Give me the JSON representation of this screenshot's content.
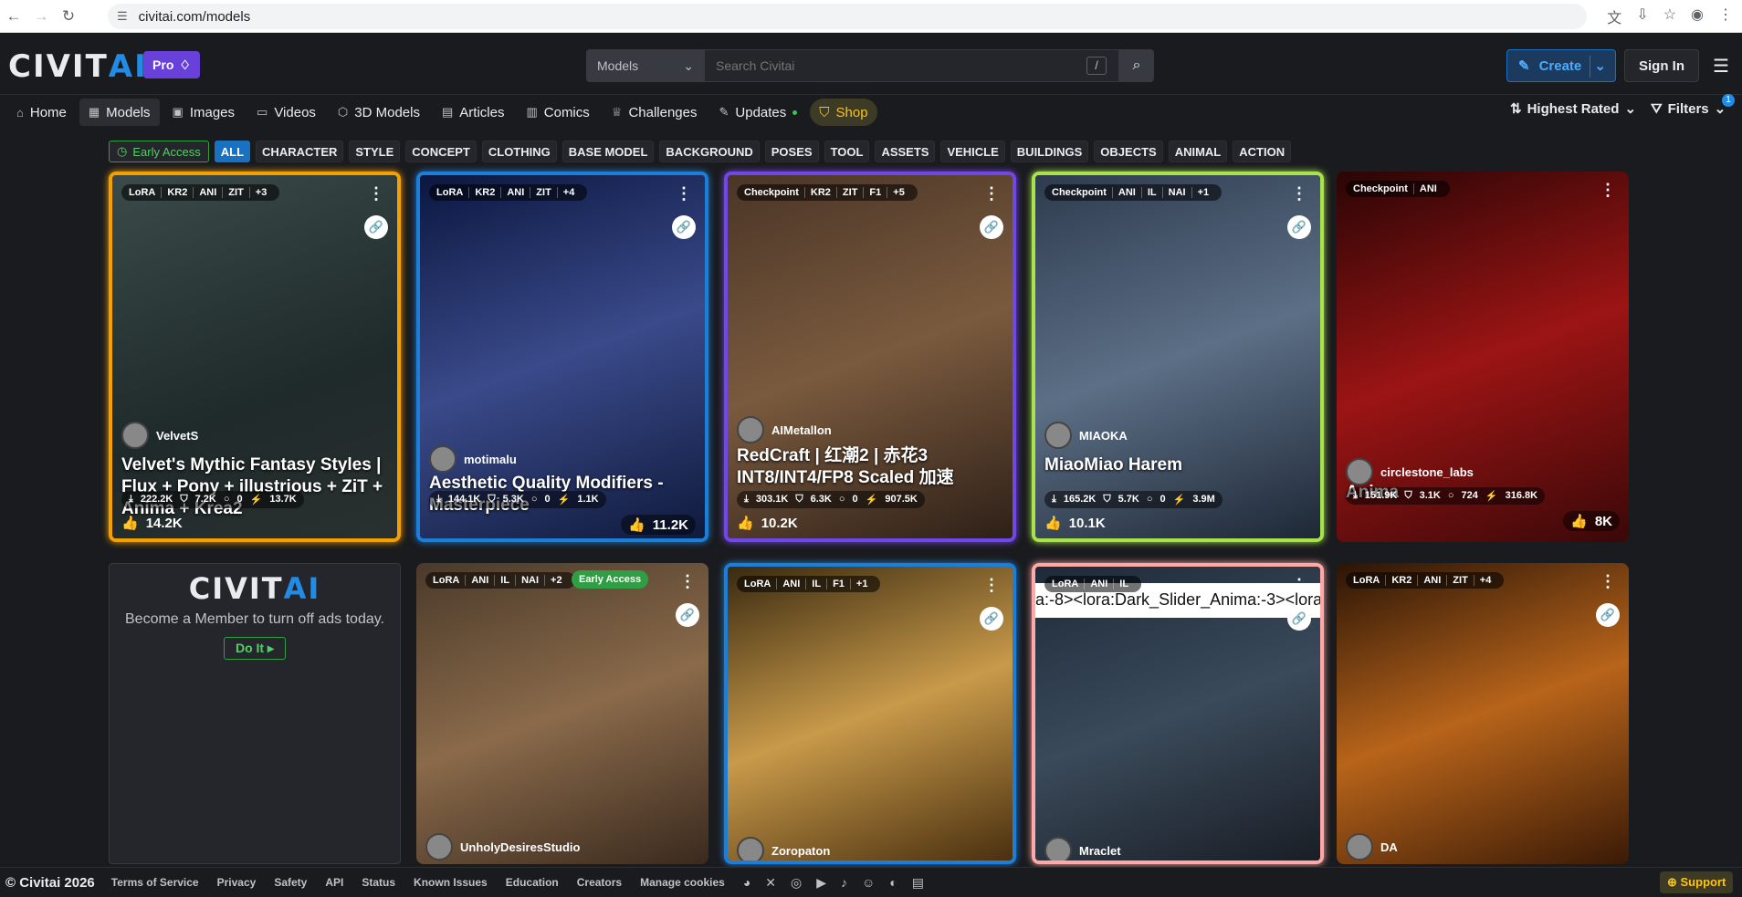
{
  "browser": {
    "url": "civitai.com/models"
  },
  "header": {
    "logo_main": "CIVIT",
    "logo_accent": "AI",
    "pro_label": "Pro",
    "search_scope": "Models",
    "search_placeholder": "Search Civitai",
    "search_shortcut": "/",
    "create_label": "Create",
    "signin_label": "Sign In"
  },
  "subnav": {
    "items": [
      "Home",
      "Models",
      "Images",
      "Videos",
      "3D Models",
      "Articles",
      "Comics",
      "Challenges",
      "Updates",
      "Shop"
    ],
    "sort_label": "Highest Rated",
    "filters_label": "Filters",
    "filters_count": "1"
  },
  "tags": [
    "Early Access",
    "ALL",
    "CHARACTER",
    "STYLE",
    "CONCEPT",
    "CLOTHING",
    "BASE MODEL",
    "BACKGROUND",
    "POSES",
    "TOOL",
    "ASSETS",
    "VEHICLE",
    "BUILDINGS",
    "OBJECTS",
    "ANIMAL",
    "ACTION"
  ],
  "cards": [
    {
      "chips": [
        "LoRA",
        "KR2",
        "ANI",
        "ZIT",
        "+3"
      ],
      "creator": "VelvetS",
      "title": "Velvet's Mythic Fantasy Styles | Flux + Pony + illustrious + ZiT + Anima + Krea2",
      "downloads": "222.2K",
      "saves": "7.2K",
      "comments": "0",
      "buzz": "13.7K",
      "likes": "14.2K",
      "border": "#f59f00"
    },
    {
      "chips": [
        "LoRA",
        "KR2",
        "ANI",
        "ZIT",
        "+4"
      ],
      "creator": "motimalu",
      "title": "Aesthetic Quality Modifiers - Masterpiece",
      "downloads": "144.1K",
      "saves": "5.3K",
      "comments": "0",
      "buzz": "1.1K",
      "likes": "11.2K",
      "border": "#1c7ed6"
    },
    {
      "chips": [
        "Checkpoint",
        "KR2",
        "ZIT",
        "F1",
        "+5"
      ],
      "creator": "AIMetallon",
      "title": "RedCraft | 红潮2 | 赤花3 INT8/INT4/FP8 Scaled 加速",
      "downloads": "303.1K",
      "saves": "6.3K",
      "comments": "0",
      "buzz": "907.5K",
      "likes": "10.2K",
      "border": "#7048e8"
    },
    {
      "chips": [
        "Checkpoint",
        "ANI",
        "IL",
        "NAI",
        "+1"
      ],
      "creator": "MIAOKA",
      "title": "MiaoMiao Harem",
      "downloads": "165.2K",
      "saves": "5.7K",
      "comments": "0",
      "buzz": "3.9M",
      "likes": "10.1K",
      "border": "#a9e34b"
    },
    {
      "chips": [
        "Checkpoint",
        "ANI"
      ],
      "creator": "circlestone_labs",
      "title": "Anima",
      "downloads": "151.9K",
      "saves": "3.1K",
      "comments": "724",
      "buzz": "316.8K",
      "likes": "8K",
      "border": "#1a1b1e"
    }
  ],
  "row2": [
    {
      "chips": [
        "LoRA",
        "ANI",
        "IL",
        "NAI",
        "+2"
      ],
      "early": "Early Access",
      "creator": "UnholyDesiresStudio"
    },
    {
      "chips": [
        "LoRA",
        "ANI",
        "IL",
        "F1",
        "+1"
      ],
      "creator": "Zoropaton"
    },
    {
      "chips": [
        "LoRA",
        "ANI",
        "IL"
      ],
      "creator": "Mraclet",
      "overlay": "a:-8><lora:Dark_Slider_Anima:-3><lora"
    },
    {
      "chips": [
        "LoRA",
        "KR2",
        "ANI",
        "ZIT",
        "+4"
      ],
      "creator": "DA"
    }
  ],
  "ad": {
    "text": "Become a Member to turn off ads today.",
    "button": "Do It"
  },
  "footer": {
    "copyright": "© Civitai 2026",
    "links": [
      "Terms of Service",
      "Privacy",
      "Safety",
      "API",
      "Status",
      "Known Issues",
      "Education",
      "Creators",
      "Manage cookies"
    ],
    "support": "Support"
  }
}
